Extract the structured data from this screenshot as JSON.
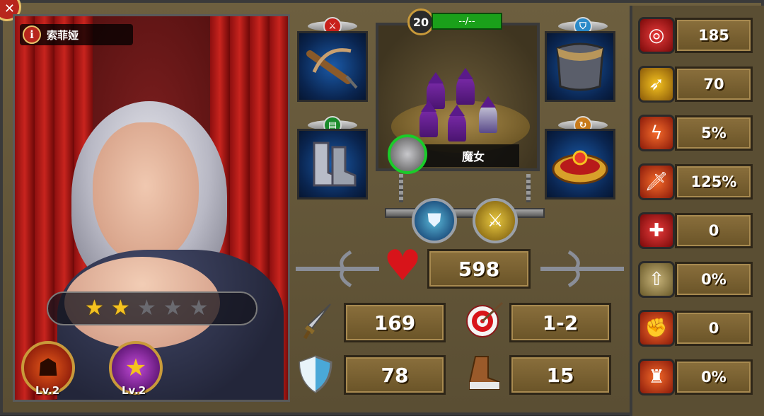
{
  "hero": {
    "name": "索菲娅",
    "stars_filled": 2,
    "stars_total": 5,
    "skills": [
      {
        "level_label": "Lv.2",
        "icon": "rage-silhouette-icon"
      },
      {
        "level_label": "Lv.2",
        "icon": "star-laurel-icon"
      }
    ]
  },
  "equipment": {
    "slots": [
      {
        "icon": "crossbow-icon",
        "badge_icon": "sword-badge-icon"
      },
      {
        "icon": "boots-icon",
        "badge_icon": "book-badge-icon"
      },
      {
        "icon": "chainmail-armor-icon",
        "badge_icon": "shield-badge-icon"
      },
      {
        "icon": "crown-icon",
        "badge_icon": "refresh-badge-icon"
      }
    ]
  },
  "squad": {
    "level": "20",
    "xp_text": "--/--",
    "unit_name": "魔女"
  },
  "stats": {
    "health": "598",
    "attack": "169",
    "range": "1-2",
    "defense": "78",
    "speed": "15"
  },
  "side_stats": [
    {
      "icon": "target-icon",
      "value": "185",
      "color": "#c8102a"
    },
    {
      "icon": "dodge-icon",
      "value": "70",
      "color": "#e8a21a"
    },
    {
      "icon": "crit-lightning-icon",
      "value": "5%",
      "color": "#c8381a"
    },
    {
      "icon": "crit-damage-sword-icon",
      "value": "125%",
      "color": "#c8381a"
    },
    {
      "icon": "heal-cross-icon",
      "value": "0",
      "color": "#c8102a"
    },
    {
      "icon": "rank-up-icon",
      "value": "0%",
      "color": "#9a8a5a"
    },
    {
      "icon": "fist-icon",
      "value": "0",
      "color": "#c8381a"
    },
    {
      "icon": "power-figure-icon",
      "value": "0%",
      "color": "#c8381a"
    }
  ],
  "ui": {
    "info_glyph": "i",
    "close_glyph": "✕",
    "star_glyph": "★",
    "heart_glyph": "♥"
  }
}
